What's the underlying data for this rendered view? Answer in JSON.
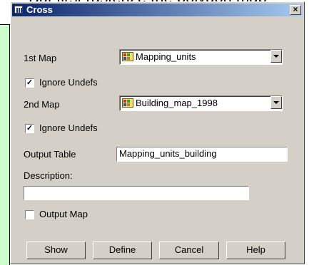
{
  "background": {
    "text": "But first rasterize the polygon map"
  },
  "dialog": {
    "title": "Cross",
    "close_glyph": "×",
    "first_map": {
      "label": "1st Map",
      "value": "Mapping_units",
      "icon": "raster-map-icon",
      "ignore_undefs_label": "Ignore Undefs",
      "ignore_undefs_checked": true
    },
    "second_map": {
      "label": "2nd Map",
      "value": "Building_map_1998",
      "icon": "raster-map-icon",
      "ignore_undefs_label": "Ignore Undefs",
      "ignore_undefs_checked": true
    },
    "output_table": {
      "label": "Output Table",
      "value": "Mapping_units_building"
    },
    "description": {
      "label": "Description:",
      "value": ""
    },
    "output_map": {
      "label": "Output Map",
      "checked": false
    },
    "buttons": {
      "show": "Show",
      "define": "Define",
      "cancel": "Cancel",
      "help": "Help"
    }
  },
  "colors": {
    "dialog_bg": "#d4d0c8",
    "titlebar_start": "#0a246a",
    "titlebar_end": "#a6caf0",
    "note_panel_bg": "#ccffcc"
  }
}
